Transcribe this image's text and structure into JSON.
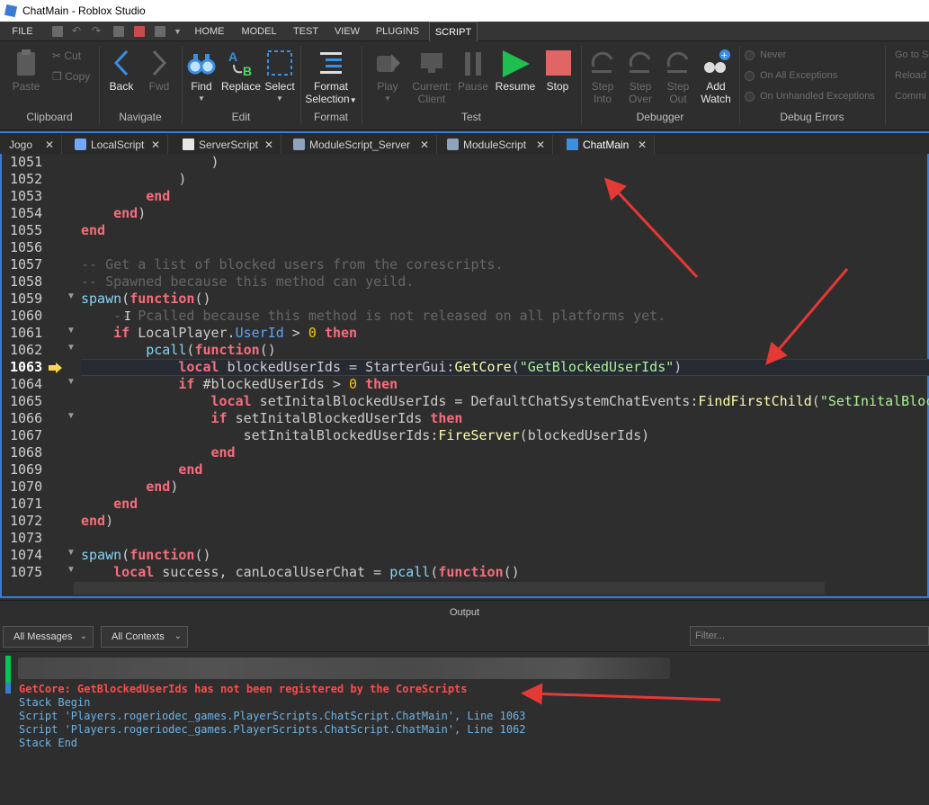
{
  "window": {
    "title": "ChatMain - Roblox Studio"
  },
  "menu": {
    "file": "FILE",
    "tabs": [
      "HOME",
      "MODEL",
      "TEST",
      "VIEW",
      "PLUGINS",
      "SCRIPT"
    ],
    "active_tab": "SCRIPT"
  },
  "ribbon": {
    "clipboard": {
      "paste": "Paste",
      "cut": "Cut",
      "copy": "Copy",
      "group": "Clipboard"
    },
    "navigate": {
      "back": "Back",
      "fwd": "Fwd",
      "group": "Navigate"
    },
    "edit": {
      "find": "Find",
      "replace": "Replace",
      "select": "Select",
      "group": "Edit"
    },
    "format": {
      "format_selection_1": "Format",
      "format_selection_2": "Selection",
      "group": "Format"
    },
    "test": {
      "play": "Play",
      "current_1": "Current:",
      "current_2": "Client",
      "pause": "Pause",
      "resume": "Resume",
      "stop": "Stop",
      "group": "Test"
    },
    "debugger": {
      "step_into_1": "Step",
      "step_into_2": "Into",
      "step_over_1": "Step",
      "step_over_2": "Over",
      "step_out_1": "Step",
      "step_out_2": "Out",
      "add_watch_1": "Add",
      "add_watch_2": "Watch",
      "group": "Debugger"
    },
    "debug_errors": {
      "never": "Never",
      "all": "On All Exceptions",
      "unhandled": "On Unhandled Exceptions",
      "group": "Debug Errors"
    },
    "overflow": {
      "goto": "Go to Sc",
      "reload": "Reload",
      "commit": "Commi"
    }
  },
  "editor_tabs": [
    {
      "label": "Jogo",
      "icon": "none"
    },
    {
      "label": "LocalScript",
      "icon": "localscript-icon"
    },
    {
      "label": "ServerScript",
      "icon": "script-icon"
    },
    {
      "label": "ModuleScript_Server",
      "icon": "modulescript-icon"
    },
    {
      "label": "ModuleScript",
      "icon": "modulescript-icon"
    },
    {
      "label": "ChatMain",
      "icon": "monitor-icon",
      "active": true
    }
  ],
  "editor": {
    "current_line": "1063",
    "lines": [
      "1051",
      "1052",
      "1053",
      "1054",
      "1055",
      "1056",
      "1057",
      "1058",
      "1059",
      "1060",
      "1061",
      "1062",
      "1063",
      "1064",
      "1065",
      "1066",
      "1067",
      "1068",
      "1069",
      "1070",
      "1071",
      "1072",
      "1073",
      "1074",
      "1075"
    ]
  },
  "output": {
    "title": "Output",
    "filter_messages": "All Messages",
    "filter_contexts": "All Contexts",
    "filter_placeholder": "Filter...",
    "lines": {
      "error": "GetCore: GetBlockedUserIds has not been registered by the CoreScripts",
      "stack_begin": "Stack Begin",
      "trace1": "Script 'Players.rogeriodec_games.PlayerScripts.ChatScript.ChatMain', Line 1063",
      "trace2": "Script 'Players.rogeriodec_games.PlayerScripts.ChatScript.ChatMain', Line 1062",
      "stack_end": "Stack End"
    }
  },
  "colors": {
    "accent": "#3a7bd5",
    "annotation_arrow": "#e53935",
    "error": "#ff4b4b",
    "info": "#6cb4e8"
  }
}
